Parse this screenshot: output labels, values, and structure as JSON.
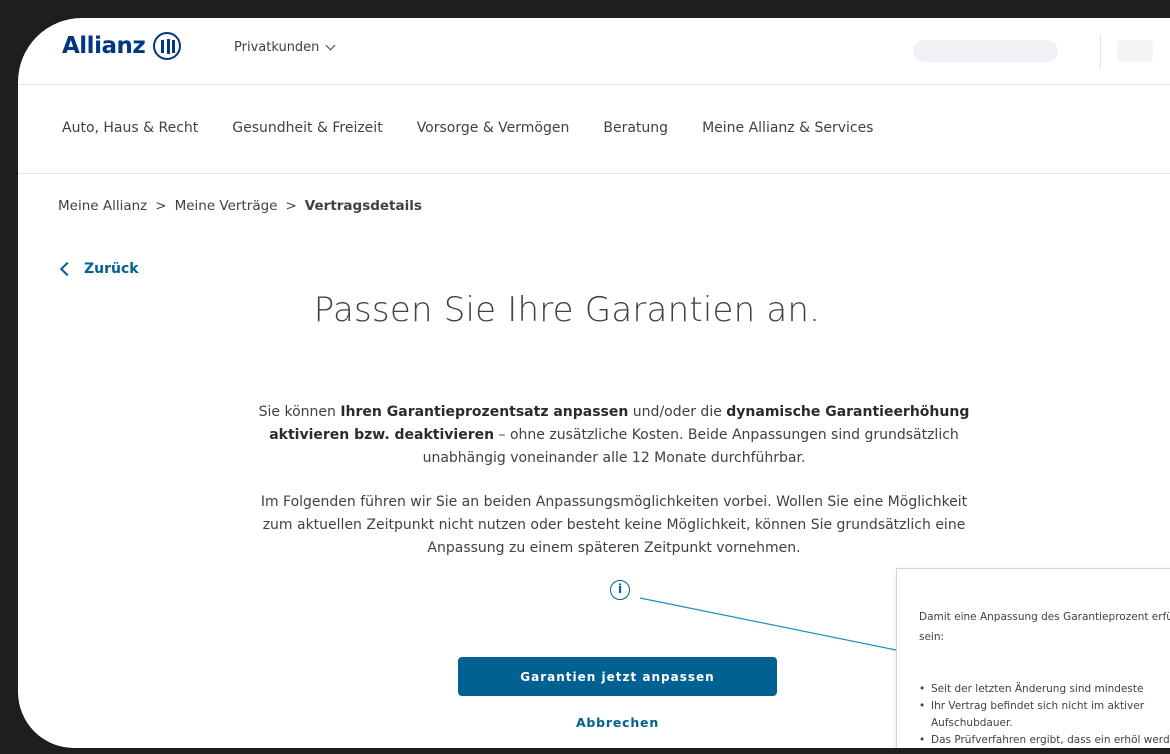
{
  "brand": {
    "name": "Allianz",
    "color": "#003781",
    "accent": "#006192"
  },
  "header": {
    "segment_label": "Privatkunden"
  },
  "nav": {
    "items": [
      {
        "label": "Auto, Haus & Recht"
      },
      {
        "label": "Gesundheit & Freizeit"
      },
      {
        "label": "Vorsorge & Vermögen"
      },
      {
        "label": "Beratung"
      },
      {
        "label": "Meine Allianz & Services"
      }
    ]
  },
  "breadcrumb": {
    "items": [
      "Meine Allianz",
      "Meine Verträge",
      "Vertragsdetails"
    ],
    "separator": ">"
  },
  "back_label": "Zurück",
  "page_title": "Passen Sie Ihre Garantien an.",
  "intro": {
    "p1_a": "Sie können ",
    "p1_b": "Ihren Garantieprozentsatz anpassen",
    "p1_c": " und/oder die ",
    "p1_d": "dynamische Garantieerhöhung aktivieren bzw. deaktivieren",
    "p1_e": " – ohne zusätzliche Kosten. Beide Anpassungen sind grundsätzlich unabhängig voneinander alle 12 Monate durchführbar.",
    "p2": "Im Folgenden führen wir Sie an beiden Anpassungsmöglichkeiten vorbei. Wollen Sie eine Möglichkeit zum aktuellen Zeitpunkt nicht nutzen oder besteht keine Möglichkeit, können Sie grundsätzlich eine Anpassung zu einem späteren Zeitpunkt vornehmen."
  },
  "info_icon_glyph": "i",
  "buttons": {
    "primary": "Garantien jetzt anpassen",
    "secondary": "Abbrechen"
  },
  "tooltip": {
    "lead": "Damit eine Anpassung des Garantieprozent erfüllt sein:",
    "items": [
      "Seit der letzten Änderung sind mindeste",
      "Ihr Vertrag befindet sich nicht im aktiver Aufschubdauer.",
      "Das Prüfverfahren ergibt, dass ein erhöl werden kann."
    ]
  }
}
